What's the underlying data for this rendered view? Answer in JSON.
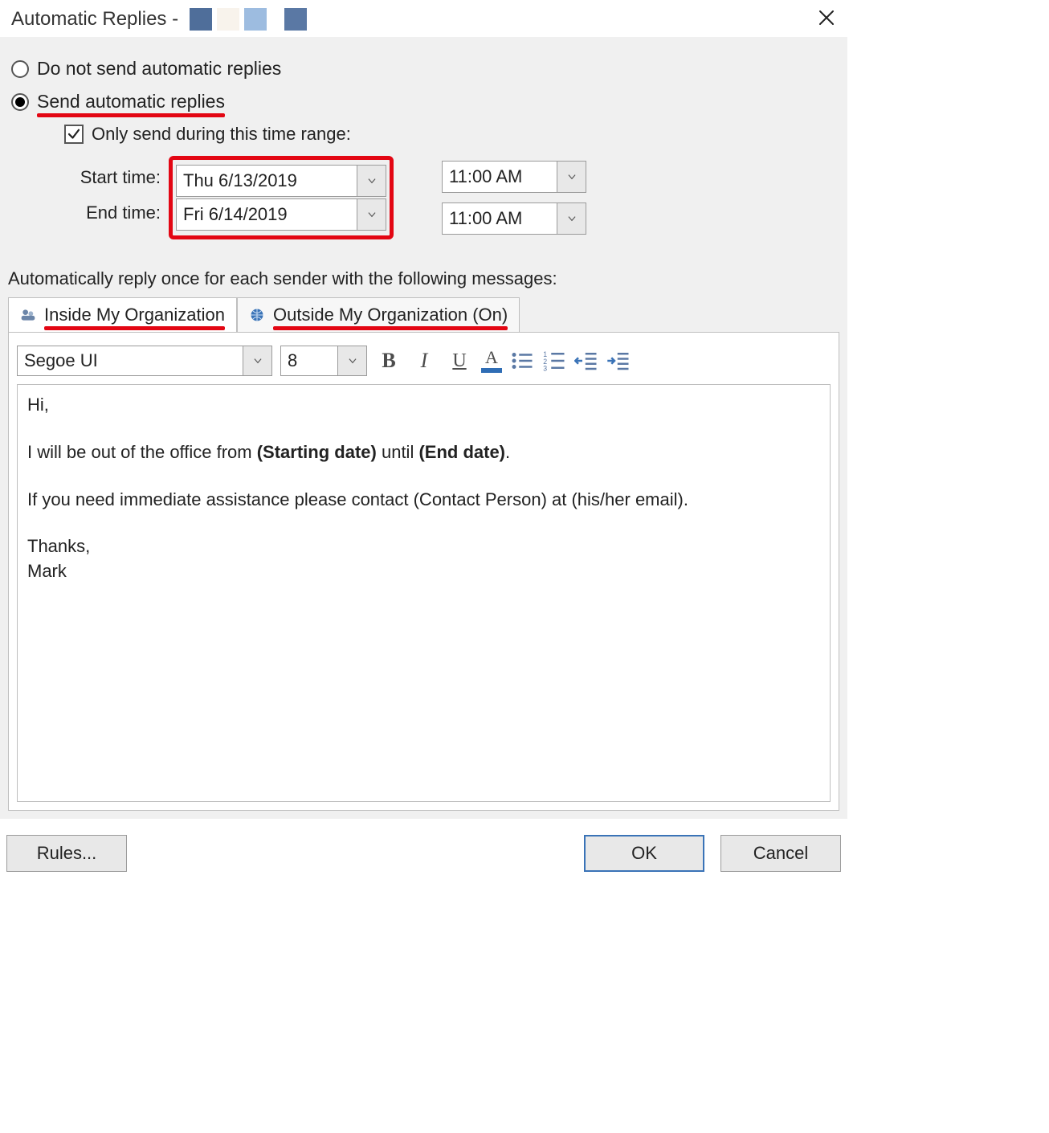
{
  "titlebar": {
    "title": "Automatic Replies -"
  },
  "radios": {
    "do_not_send": "Do not send automatic replies",
    "send": "Send automatic replies",
    "selected": "send"
  },
  "only_range": {
    "label": "Only send during this time range:",
    "checked": true
  },
  "time": {
    "start_label": "Start time:",
    "start_date": "Thu 6/13/2019",
    "start_time": "11:00 AM",
    "end_label": "End time:",
    "end_date": "Fri 6/14/2019",
    "end_time": "11:00 AM"
  },
  "instruction": "Automatically reply once for each sender with the following messages:",
  "tabs": {
    "inside": "Inside My Organization",
    "outside": "Outside My Organization (On)",
    "active": "inside"
  },
  "toolbar": {
    "font": "Segoe UI",
    "size": "8"
  },
  "message": {
    "l1": "Hi,",
    "l2a": "I will be out of the office from ",
    "l2b": "(Starting date)",
    "l2c": " until ",
    "l2d": "(End date)",
    "l2e": ".",
    "l3": "If you need immediate assistance please contact (Contact Person) at (his/her email).",
    "l4": "Thanks,",
    "l5": "Mark"
  },
  "buttons": {
    "rules": "Rules...",
    "ok": "OK",
    "cancel": "Cancel"
  }
}
